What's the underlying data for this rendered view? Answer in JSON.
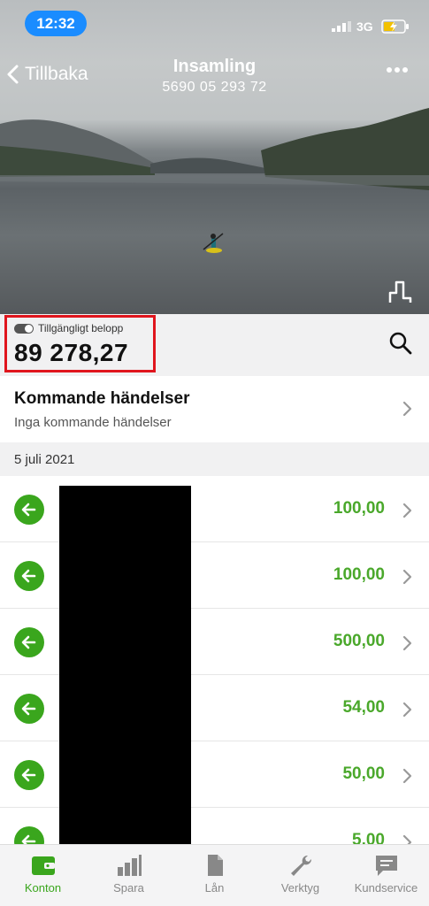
{
  "status_bar": {
    "time": "12:32",
    "network": "3G"
  },
  "header": {
    "back_label": "Tillbaka",
    "title": "Insamling",
    "account_number": "5690 05 293 72"
  },
  "balance": {
    "label": "Tillgängligt belopp",
    "amount": "89 278,27"
  },
  "upcoming": {
    "title": "Kommande händelser",
    "subtitle": "Inga kommande händelser"
  },
  "date_header": "5 juli 2021",
  "transactions": [
    {
      "amount": "100,00"
    },
    {
      "amount": "100,00"
    },
    {
      "amount": "500,00"
    },
    {
      "amount": "54,00"
    },
    {
      "amount": "50,00"
    },
    {
      "amount": "5,00"
    }
  ],
  "tabs": [
    {
      "label": "Konton",
      "icon": "wallet-icon",
      "active": true
    },
    {
      "label": "Spara",
      "icon": "savings-chart-icon",
      "active": false
    },
    {
      "label": "Lån",
      "icon": "document-icon",
      "active": false
    },
    {
      "label": "Verktyg",
      "icon": "wrench-icon",
      "active": false
    },
    {
      "label": "Kundservice",
      "icon": "chat-icon",
      "active": false
    }
  ],
  "colors": {
    "accent_green": "#3aa61d",
    "amount_green": "#4aa82b",
    "highlight_red": "#e0151d",
    "status_blue": "#1a8cff"
  }
}
